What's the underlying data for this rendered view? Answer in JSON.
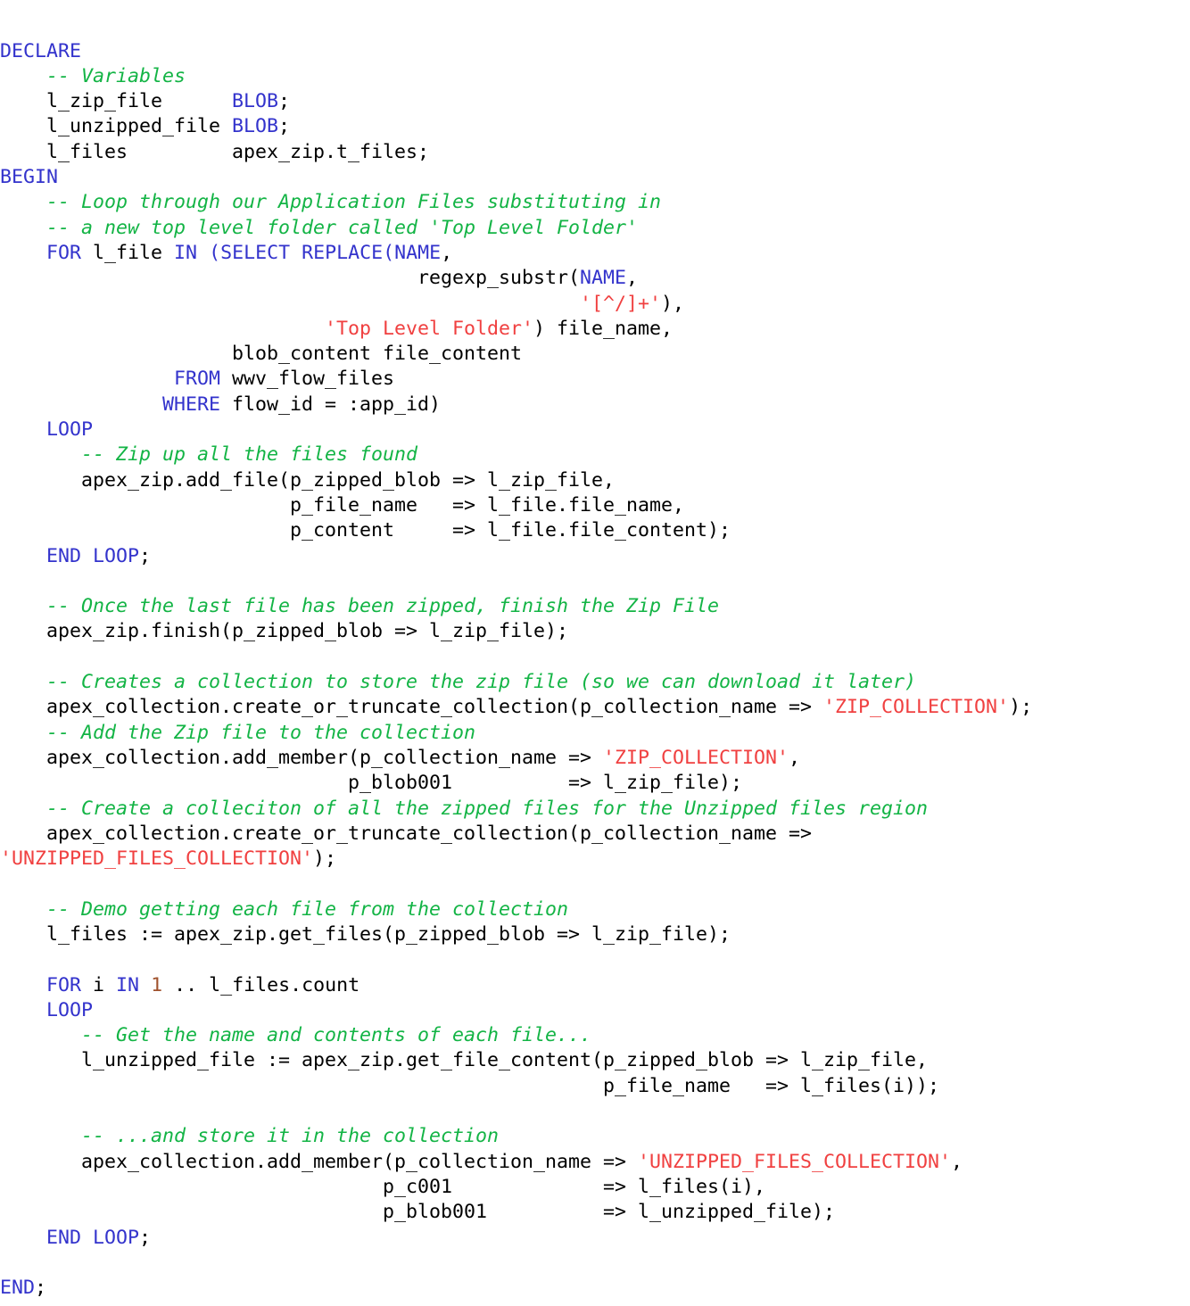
{
  "document": {
    "title": "PL/SQL APEX Zip Example",
    "language": "plsql",
    "background_color": "#ffffff",
    "colors": {
      "keyword": "#3333cc",
      "comment": "#13b445",
      "string": "#f04040",
      "number": "#a0522d",
      "plain": "#000000"
    }
  },
  "code": {
    "lines": [
      {
        "tokens": [
          {
            "t": "DECLARE",
            "c": "kw"
          }
        ]
      },
      {
        "tokens": [
          {
            "t": "    ",
            "c": "plain"
          },
          {
            "t": "-- Variables",
            "c": "com"
          }
        ]
      },
      {
        "tokens": [
          {
            "t": "    l_zip_file      ",
            "c": "plain"
          },
          {
            "t": "BLOB",
            "c": "kw"
          },
          {
            "t": ";",
            "c": "plain"
          }
        ]
      },
      {
        "tokens": [
          {
            "t": "    l_unzipped_file ",
            "c": "plain"
          },
          {
            "t": "BLOB",
            "c": "kw"
          },
          {
            "t": ";",
            "c": "plain"
          }
        ]
      },
      {
        "tokens": [
          {
            "t": "    l_files         apex_zip.t_files;",
            "c": "plain"
          }
        ]
      },
      {
        "tokens": [
          {
            "t": "BEGIN",
            "c": "kw"
          }
        ]
      },
      {
        "tokens": [
          {
            "t": "    ",
            "c": "plain"
          },
          {
            "t": "-- Loop through our Application Files substituting in",
            "c": "com"
          }
        ]
      },
      {
        "tokens": [
          {
            "t": "    ",
            "c": "plain"
          },
          {
            "t": "-- a new top level folder called 'Top Level Folder'",
            "c": "com"
          }
        ]
      },
      {
        "tokens": [
          {
            "t": "    ",
            "c": "plain"
          },
          {
            "t": "FOR",
            "c": "kw"
          },
          {
            "t": " l_file ",
            "c": "plain"
          },
          {
            "t": "IN",
            "c": "kw"
          },
          {
            "t": " ",
            "c": "plain"
          },
          {
            "t": "(SELECT REPLACE(",
            "c": "kw"
          },
          {
            "t": "NAME",
            "c": "kw"
          },
          {
            "t": ",",
            "c": "plain"
          }
        ]
      },
      {
        "tokens": [
          {
            "t": "                                    regexp_substr(",
            "c": "plain"
          },
          {
            "t": "NAME",
            "c": "kw"
          },
          {
            "t": ",",
            "c": "plain"
          }
        ]
      },
      {
        "tokens": [
          {
            "t": "                                                  ",
            "c": "plain"
          },
          {
            "t": "'[^/]+'",
            "c": "str"
          },
          {
            "t": "),",
            "c": "plain"
          }
        ]
      },
      {
        "tokens": [
          {
            "t": "                            ",
            "c": "plain"
          },
          {
            "t": "'Top Level Folder'",
            "c": "str"
          },
          {
            "t": ") file_name,",
            "c": "plain"
          }
        ]
      },
      {
        "tokens": [
          {
            "t": "                    blob_content file_content",
            "c": "plain"
          }
        ]
      },
      {
        "tokens": [
          {
            "t": "               ",
            "c": "plain"
          },
          {
            "t": "FROM",
            "c": "kw"
          },
          {
            "t": " wwv_flow_files",
            "c": "plain"
          }
        ]
      },
      {
        "tokens": [
          {
            "t": "              ",
            "c": "plain"
          },
          {
            "t": "WHERE",
            "c": "kw"
          },
          {
            "t": " flow_id = :app_id)",
            "c": "plain"
          }
        ]
      },
      {
        "tokens": [
          {
            "t": "    ",
            "c": "plain"
          },
          {
            "t": "LOOP",
            "c": "kw"
          }
        ]
      },
      {
        "tokens": [
          {
            "t": "       ",
            "c": "plain"
          },
          {
            "t": "-- Zip up all the files found",
            "c": "com"
          }
        ]
      },
      {
        "tokens": [
          {
            "t": "       apex_zip.add_file(p_zipped_blob => l_zip_file,",
            "c": "plain"
          }
        ]
      },
      {
        "tokens": [
          {
            "t": "                         p_file_name   => l_file.file_name,",
            "c": "plain"
          }
        ]
      },
      {
        "tokens": [
          {
            "t": "                         p_content     => l_file.file_content);",
            "c": "plain"
          }
        ]
      },
      {
        "tokens": [
          {
            "t": "    ",
            "c": "plain"
          },
          {
            "t": "END LOOP",
            "c": "kw"
          },
          {
            "t": ";",
            "c": "plain"
          }
        ]
      },
      {
        "tokens": []
      },
      {
        "tokens": [
          {
            "t": "    ",
            "c": "plain"
          },
          {
            "t": "-- Once the last file has been zipped, finish the Zip File",
            "c": "com"
          }
        ]
      },
      {
        "tokens": [
          {
            "t": "    apex_zip.finish(p_zipped_blob => l_zip_file);",
            "c": "plain"
          }
        ]
      },
      {
        "tokens": []
      },
      {
        "tokens": [
          {
            "t": "    ",
            "c": "plain"
          },
          {
            "t": "-- Creates a collection to store the zip file (so we can download it later)",
            "c": "com"
          }
        ]
      },
      {
        "tokens": [
          {
            "t": "    apex_collection.create_or_truncate_collection(p_collection_name => ",
            "c": "plain"
          },
          {
            "t": "'ZIP_COLLECTION'",
            "c": "str"
          },
          {
            "t": ");",
            "c": "plain"
          }
        ]
      },
      {
        "tokens": [
          {
            "t": "    ",
            "c": "plain"
          },
          {
            "t": "-- Add the Zip file to the collection",
            "c": "com"
          }
        ]
      },
      {
        "tokens": [
          {
            "t": "    apex_collection.add_member(p_collection_name => ",
            "c": "plain"
          },
          {
            "t": "'ZIP_COLLECTION'",
            "c": "str"
          },
          {
            "t": ",",
            "c": "plain"
          }
        ]
      },
      {
        "tokens": [
          {
            "t": "                              p_blob001          => l_zip_file);",
            "c": "plain"
          }
        ]
      },
      {
        "tokens": [
          {
            "t": "    ",
            "c": "plain"
          },
          {
            "t": "-- Create a colleciton of all the zipped files for the Unzipped files region",
            "c": "com"
          }
        ]
      },
      {
        "tokens": [
          {
            "t": "    apex_collection.create_or_truncate_collection(p_collection_name =>",
            "c": "plain"
          }
        ]
      },
      {
        "tokens": [
          {
            "t": "'UNZIPPED_FILES_COLLECTION'",
            "c": "str"
          },
          {
            "t": ");",
            "c": "plain"
          }
        ]
      },
      {
        "tokens": []
      },
      {
        "tokens": [
          {
            "t": "    ",
            "c": "plain"
          },
          {
            "t": "-- Demo getting each file from the collection",
            "c": "com"
          }
        ]
      },
      {
        "tokens": [
          {
            "t": "    l_files := apex_zip.get_files(p_zipped_blob => l_zip_file);",
            "c": "plain"
          }
        ]
      },
      {
        "tokens": []
      },
      {
        "tokens": [
          {
            "t": "    ",
            "c": "plain"
          },
          {
            "t": "FOR",
            "c": "kw"
          },
          {
            "t": " i ",
            "c": "plain"
          },
          {
            "t": "IN",
            "c": "kw"
          },
          {
            "t": " ",
            "c": "plain"
          },
          {
            "t": "1",
            "c": "num"
          },
          {
            "t": " .. l_files.count",
            "c": "plain"
          }
        ]
      },
      {
        "tokens": [
          {
            "t": "    ",
            "c": "plain"
          },
          {
            "t": "LOOP",
            "c": "kw"
          }
        ]
      },
      {
        "tokens": [
          {
            "t": "       ",
            "c": "plain"
          },
          {
            "t": "-- Get the name and contents of each file...",
            "c": "com"
          }
        ]
      },
      {
        "tokens": [
          {
            "t": "       l_unzipped_file := apex_zip.get_file_content(p_zipped_blob => l_zip_file,",
            "c": "plain"
          }
        ]
      },
      {
        "tokens": [
          {
            "t": "                                                    p_file_name   => l_files(i));",
            "c": "plain"
          }
        ]
      },
      {
        "tokens": []
      },
      {
        "tokens": [
          {
            "t": "       ",
            "c": "plain"
          },
          {
            "t": "-- ...and store it in the collection",
            "c": "com"
          }
        ]
      },
      {
        "tokens": [
          {
            "t": "       apex_collection.add_member(p_collection_name => ",
            "c": "plain"
          },
          {
            "t": "'UNZIPPED_FILES_COLLECTION'",
            "c": "str"
          },
          {
            "t": ",",
            "c": "plain"
          }
        ]
      },
      {
        "tokens": [
          {
            "t": "                                 p_c001             => l_files(i),",
            "c": "plain"
          }
        ]
      },
      {
        "tokens": [
          {
            "t": "                                 p_blob001          => l_unzipped_file);",
            "c": "plain"
          }
        ]
      },
      {
        "tokens": [
          {
            "t": "    ",
            "c": "plain"
          },
          {
            "t": "END LOOP",
            "c": "kw"
          },
          {
            "t": ";",
            "c": "plain"
          }
        ]
      },
      {
        "tokens": []
      },
      {
        "tokens": [
          {
            "t": "END",
            "c": "kw"
          },
          {
            "t": ";",
            "c": "plain"
          }
        ]
      }
    ]
  }
}
